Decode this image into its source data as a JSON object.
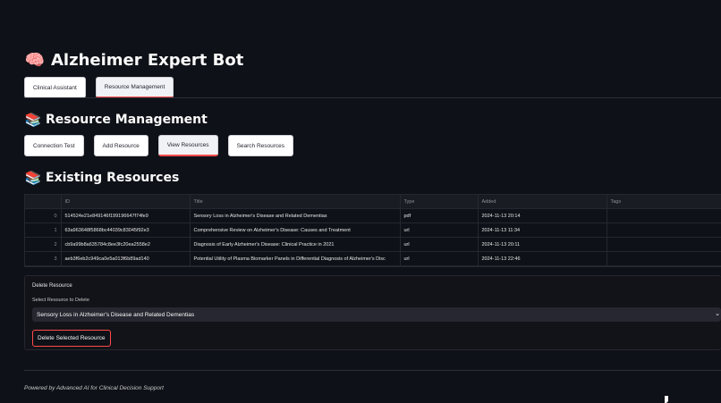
{
  "app": {
    "title_icon": "brain",
    "title": "Alzheimer Expert Bot"
  },
  "tabs": [
    {
      "label": "Clinical Assistant",
      "active": false
    },
    {
      "label": "Resource Management",
      "active": true
    }
  ],
  "resource_section": {
    "icon": "books",
    "heading": "Resource Management",
    "buttons": [
      {
        "label": "Connection Test",
        "active": false
      },
      {
        "label": "Add Resource",
        "active": false
      },
      {
        "label": "View Resources",
        "active": true
      },
      {
        "label": "Search Resources",
        "active": false
      }
    ]
  },
  "existing_section": {
    "icon": "books",
    "heading": "Existing Resources"
  },
  "table": {
    "columns": [
      "",
      "ID",
      "Title",
      "Type",
      "Added",
      "Tags"
    ],
    "rows": [
      {
        "idx": "0",
        "id": "514524e21e849146f199196647f74fe9",
        "title": "Sensory Loss in Alzheimer's Disease and Related Dementias",
        "type": "pdf",
        "added": "2024-11-13 20:14",
        "tags": ""
      },
      {
        "idx": "1",
        "id": "63a963648f5868bc44039c83045f92e3",
        "title": "Comprehensive Review on Alzheimer's Disease: Causes and Treatment",
        "type": "url",
        "added": "2024-11-13 11:34",
        "tags": ""
      },
      {
        "idx": "2",
        "id": "cb9a99b8a635784c8ee3fc20ea2558e2",
        "title": "Diagnosis of Early Alzheimer's Disease: Clinical Practice in 2021",
        "type": "url",
        "added": "2024-11-13 20:11",
        "tags": ""
      },
      {
        "idx": "3",
        "id": "aeb3f6eb2c949ca0e5a013f6b89ad140",
        "title": "Potential Utility of Plasma Biomarker Panels in Differential Diagnosis of Alzheimer's Disc",
        "type": "url",
        "added": "2024-11-13 22:46",
        "tags": ""
      }
    ]
  },
  "delete": {
    "title": "Delete Resource",
    "select_label": "Select Resource to Delete",
    "selected": "Sensory Loss in Alzheimer's Disease and Related Dementias",
    "button": "Delete Selected Resource"
  },
  "footer": "Powered by Advanced AI for Clinical Decision Support",
  "colors": {
    "background": "#0e1117",
    "accent": "#ff4b4b",
    "button_bg": "#ffffff"
  }
}
